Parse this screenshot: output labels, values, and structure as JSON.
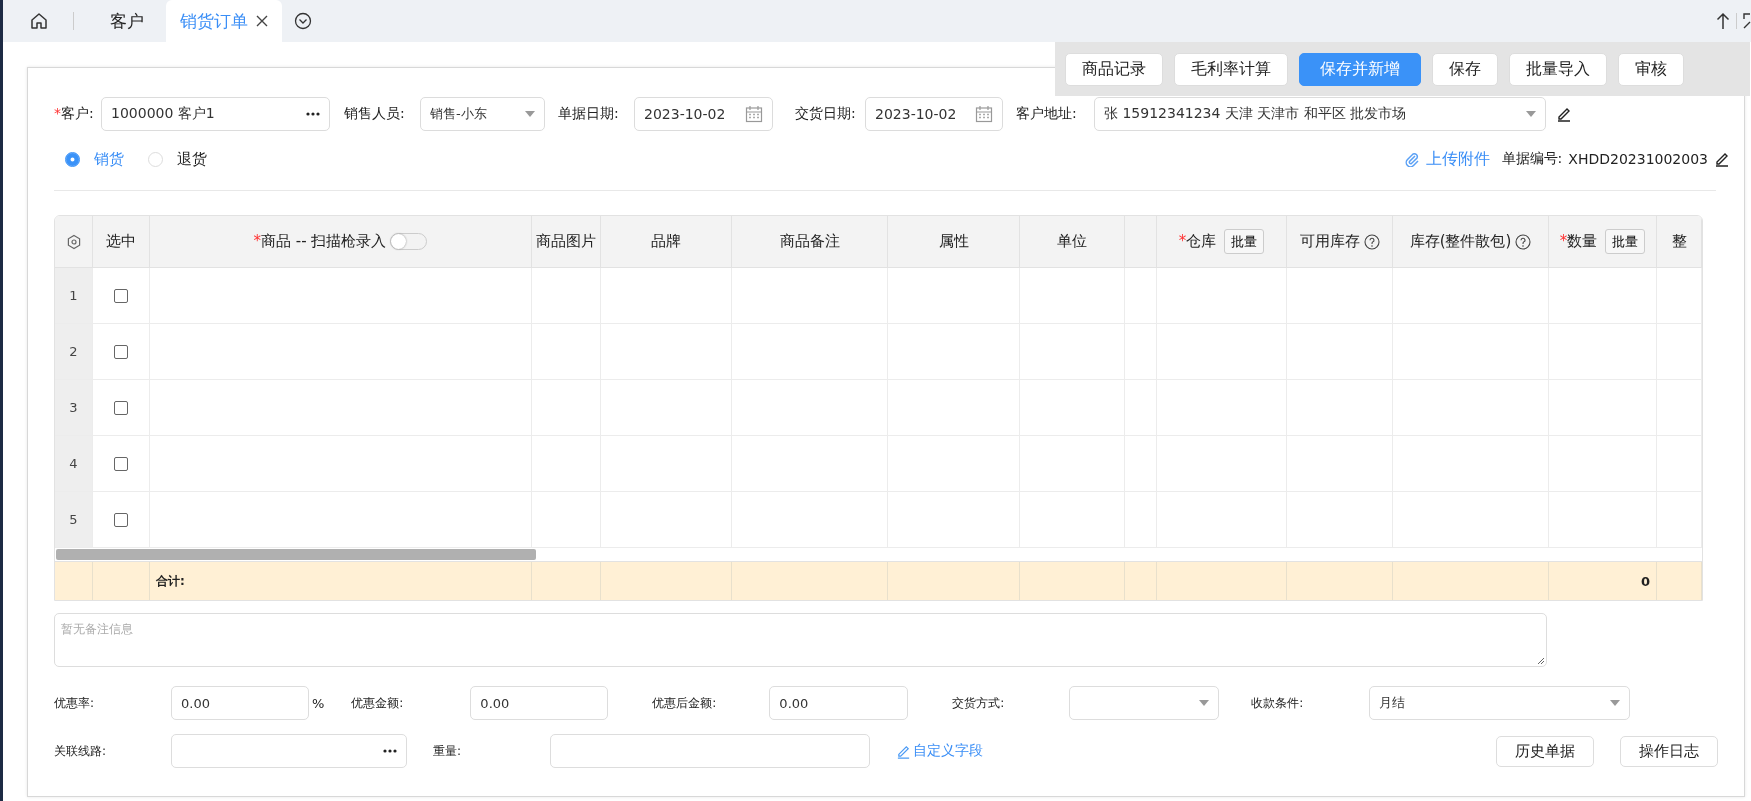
{
  "tabs": [
    {
      "label": "客户",
      "selected": false,
      "closable": false
    },
    {
      "label": "销货订单",
      "selected": true,
      "closable": true
    }
  ],
  "toolbar": [
    {
      "label": "商品记录",
      "primary": false
    },
    {
      "label": "毛利率计算",
      "primary": false
    },
    {
      "label": "保存并新增",
      "primary": true
    },
    {
      "label": "保存",
      "primary": false
    },
    {
      "label": "批量导入",
      "primary": false
    },
    {
      "label": "审核",
      "primary": false
    }
  ],
  "header_fields": [
    {
      "kind": "lookup",
      "required_mark": "*",
      "label": "客户:",
      "value": "1000000 客户1"
    },
    {
      "kind": "select",
      "label": "销售人员:",
      "value": "销售-小东"
    },
    {
      "kind": "date",
      "label": "单据日期:",
      "value": "2023-10-02"
    },
    {
      "kind": "date",
      "label": "交货日期:",
      "value": "2023-10-02"
    },
    {
      "kind": "address",
      "label": "客户地址:",
      "value": "张 15912341234 天津 天津市 和平区 批发市场"
    }
  ],
  "order_type": [
    {
      "label": "销货",
      "selected": true
    },
    {
      "label": "退货",
      "selected": false
    }
  ],
  "upload_link": "上传附件",
  "doc_number": {
    "label": "单据编号:",
    "value": "XHDD20231002003"
  },
  "table": {
    "columns": [
      {
        "kind": "settings"
      },
      {
        "kind": "plain",
        "label": "选中"
      },
      {
        "kind": "scanner",
        "required_mark": "*",
        "label": "商品 -- 扫描枪录入",
        "switch_on": false
      },
      {
        "kind": "plain",
        "label": "商品图片"
      },
      {
        "kind": "plain",
        "label": "品牌"
      },
      {
        "kind": "plain",
        "label": "商品备注"
      },
      {
        "kind": "plain",
        "label": "属性"
      },
      {
        "kind": "plain",
        "label": "单位"
      },
      {
        "kind": "blank"
      },
      {
        "kind": "batch",
        "required_mark": "*",
        "label": "仓库",
        "button": "批量"
      },
      {
        "kind": "help",
        "label": "可用库存"
      },
      {
        "kind": "help",
        "label": "库存(整件散包)"
      },
      {
        "kind": "batch",
        "required_mark": "*",
        "label": "数量",
        "button": "批量"
      },
      {
        "kind": "plain",
        "label": "整"
      }
    ],
    "rows": [
      {
        "number": "1",
        "checked": false
      },
      {
        "number": "2",
        "checked": false
      },
      {
        "number": "3",
        "checked": false
      },
      {
        "number": "4",
        "checked": false
      },
      {
        "number": "5",
        "checked": false
      }
    ],
    "total": {
      "label": "合计:",
      "quantity": "0"
    }
  },
  "remark": {
    "placeholder": "暂无备注信息"
  },
  "footer_row_1": [
    {
      "kind": "input",
      "label": "优惠率:",
      "value": "0.00",
      "suffix": "%"
    },
    {
      "kind": "input",
      "label": "优惠金额:",
      "value": "0.00"
    },
    {
      "kind": "input",
      "label": "优惠后金额:",
      "value": "0.00"
    },
    {
      "kind": "select",
      "label": "交货方式:"
    },
    {
      "kind": "select",
      "label": "收款条件:",
      "value": "月结"
    }
  ],
  "footer_row_2": [
    {
      "kind": "lookup",
      "label": "关联线路:"
    },
    {
      "kind": "input",
      "label": "重量:"
    }
  ],
  "custom_fields_link": "自定义字段",
  "footer_buttons": [
    "历史单据",
    "操作日志"
  ]
}
